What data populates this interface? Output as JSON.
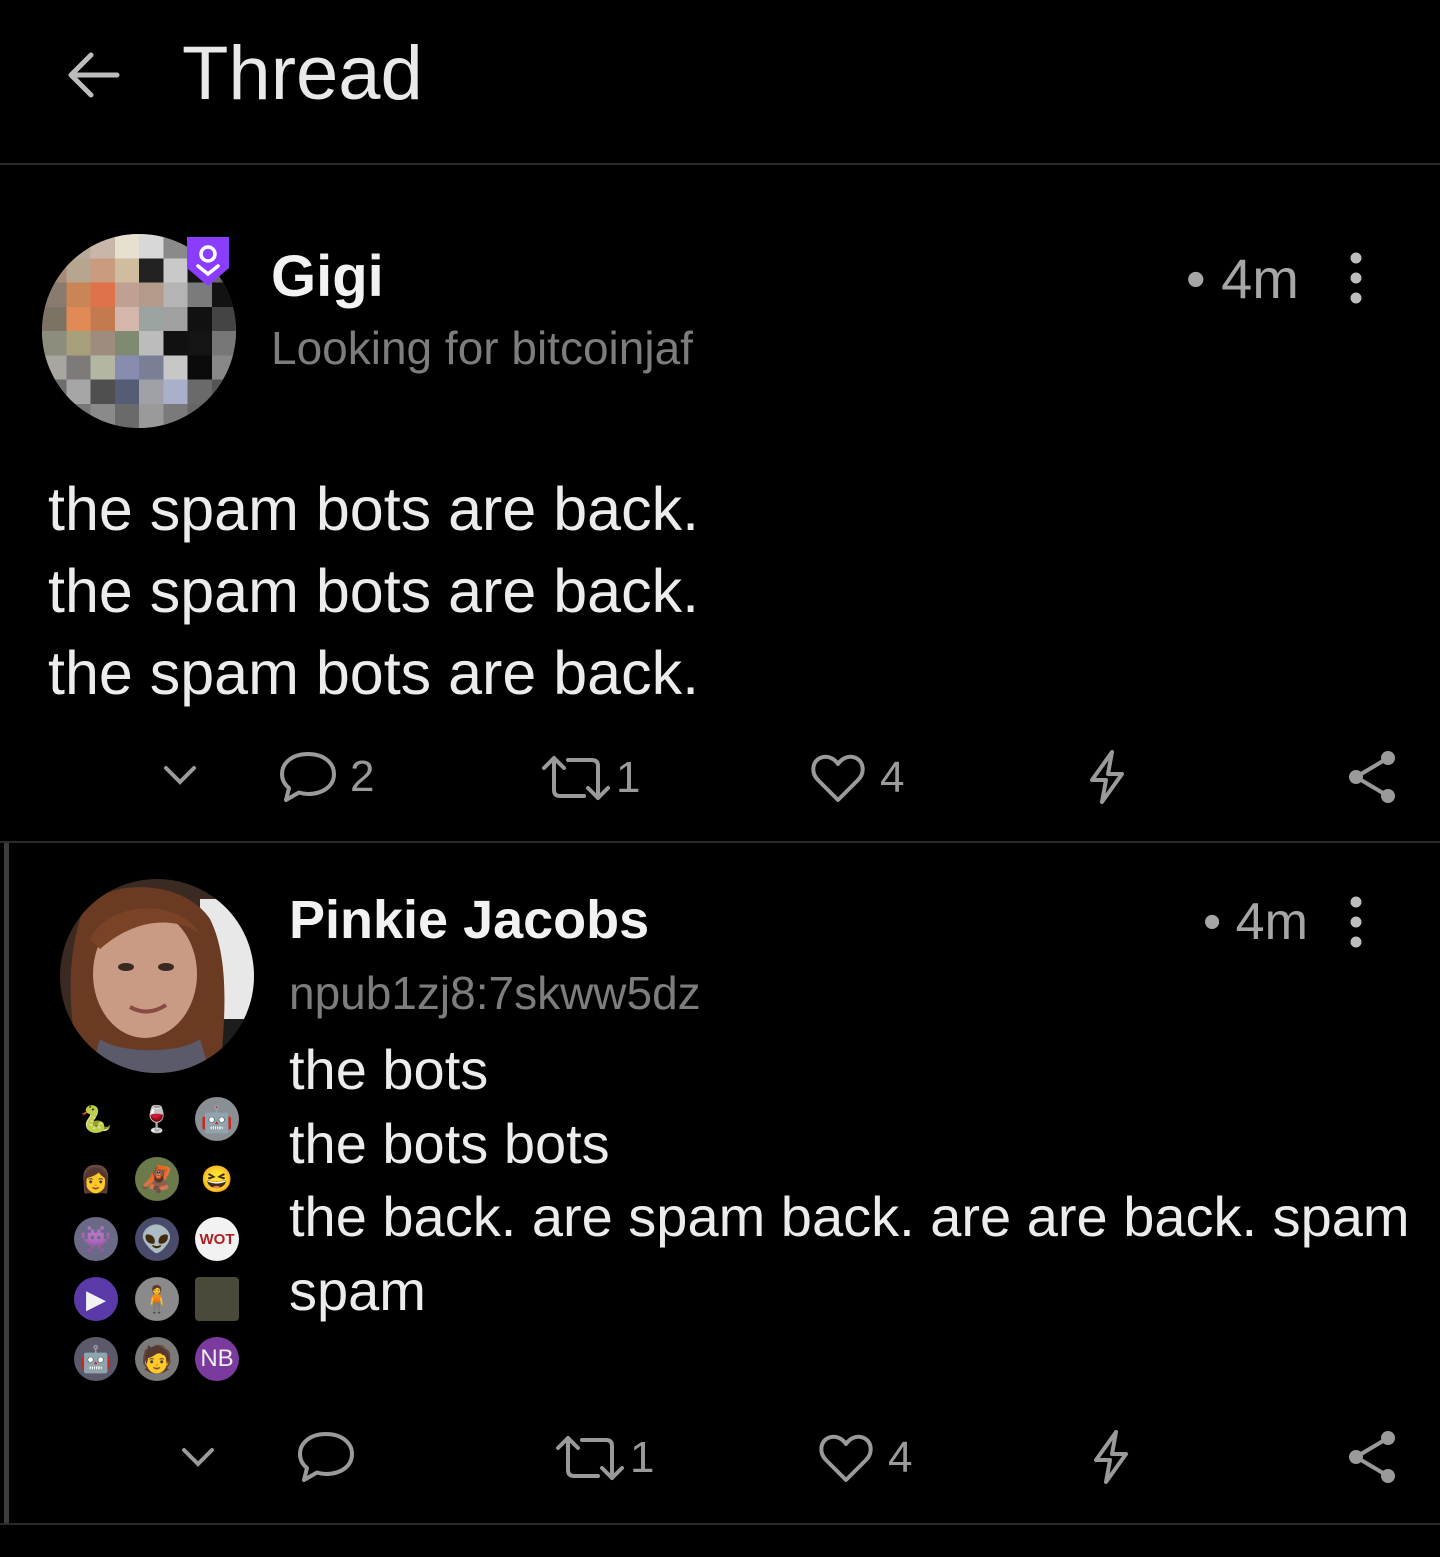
{
  "header": {
    "title": "Thread"
  },
  "post": {
    "author": "Gigi",
    "subtitle": "Looking for bitcoinjaf",
    "time": "• 4m",
    "lines": [
      "the spam bots are back.",
      "the spam bots are back.",
      "the spam bots are back."
    ],
    "replies": "2",
    "reposts": "1",
    "likes": "4"
  },
  "reply": {
    "author": "Pinkie Jacobs",
    "subtitle": "npub1zj8:7skww5dz",
    "time": "• 4m",
    "lines": [
      "the bots",
      "the bots bots",
      "the back. are spam back. are are back. spam",
      "spam"
    ],
    "replies": "",
    "reposts": "1",
    "likes": "4",
    "badge_text": "NB",
    "wot_text": "WOT"
  },
  "colors": {
    "accent": "#8b3dff",
    "badge": "#7a3a9e",
    "background": "#000000",
    "muted": "#9a9a9a"
  }
}
